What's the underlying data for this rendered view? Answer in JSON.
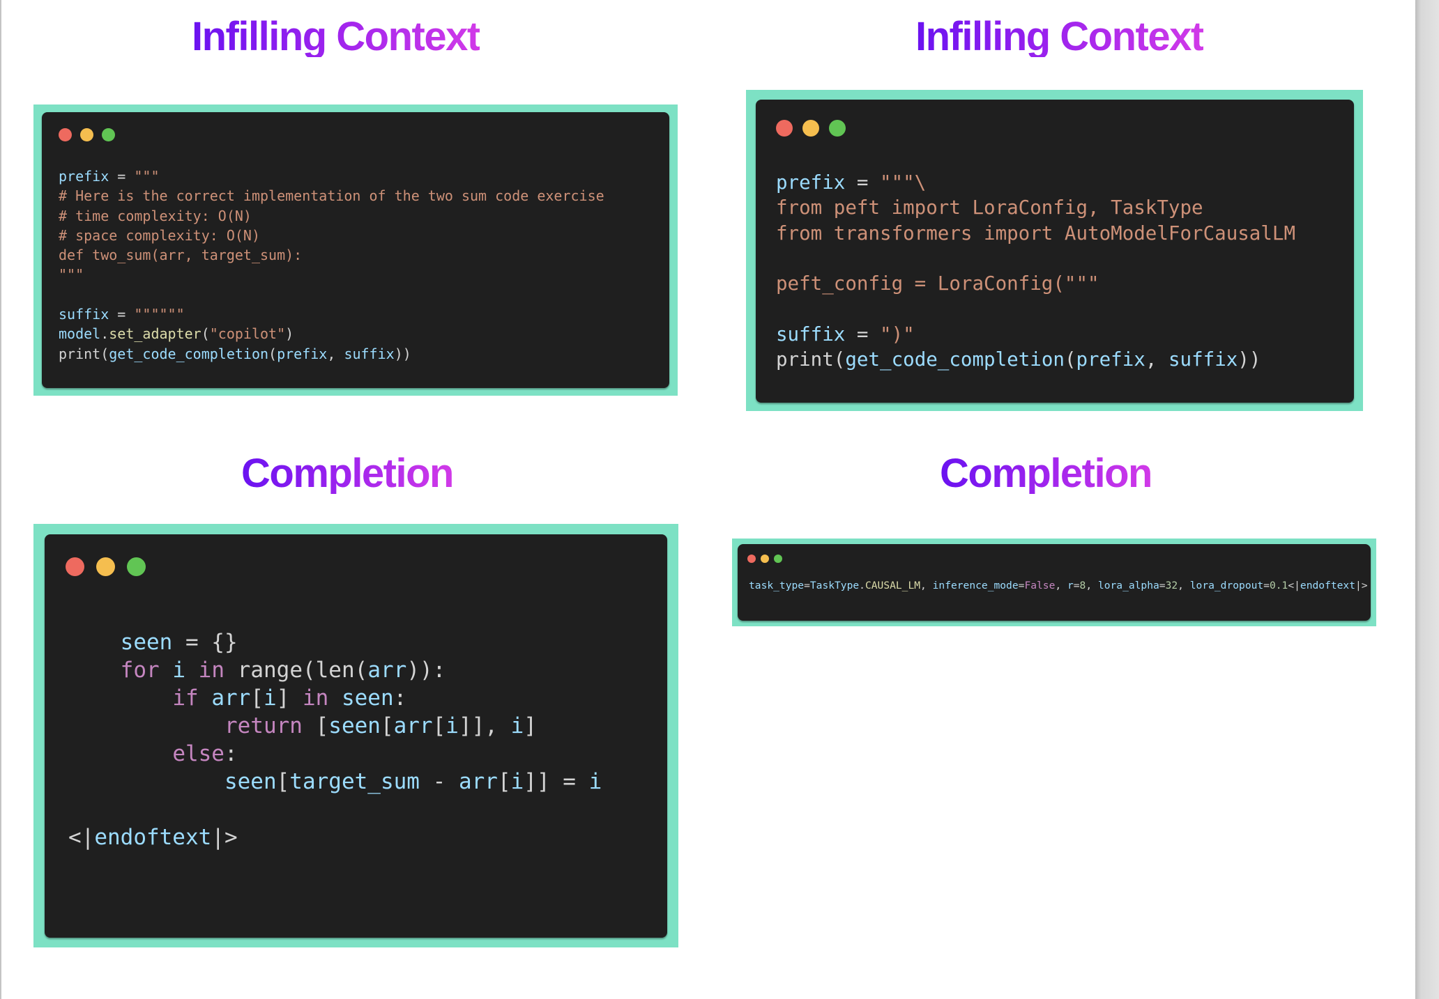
{
  "theme": {
    "frame_color": "#7de1c4",
    "window_bg": "#1f1f1f",
    "heading_gradient": [
      "#6a12f0",
      "#d13ae8"
    ],
    "traffic_lights": {
      "red": "#ee6a5f",
      "yellow": "#f5be4f",
      "green": "#61c554"
    },
    "syntax": {
      "variable": "#9cdcfe",
      "string": "#ce9178",
      "function": "#dcdcaa",
      "keyword": "#c586c0",
      "plain": "#d4d4d4",
      "number": "#b5cea8"
    }
  },
  "panels": {
    "left_context": {
      "heading": "Infilling Context",
      "window_icons": [
        "close-dot-icon",
        "minimize-dot-icon",
        "maximize-dot-icon"
      ],
      "lines": [
        [
          {
            "t": "prefix",
            "c": "var"
          },
          {
            "t": " = ",
            "c": "plain"
          },
          {
            "t": "\"\"\"",
            "c": "str"
          }
        ],
        [
          {
            "t": "# Here is the correct implementation of the two sum code exercise",
            "c": "str"
          }
        ],
        [
          {
            "t": "# time complexity: O(N)",
            "c": "str"
          }
        ],
        [
          {
            "t": "# space complexity: O(N)",
            "c": "str"
          }
        ],
        [
          {
            "t": "def two_sum(arr, target_sum):",
            "c": "str"
          }
        ],
        [
          {
            "t": "\"\"\"",
            "c": "str"
          }
        ],
        [
          {
            "t": " ",
            "c": "plain"
          }
        ],
        [
          {
            "t": "suffix",
            "c": "var"
          },
          {
            "t": " = ",
            "c": "plain"
          },
          {
            "t": "\"\"\"\"\"\"",
            "c": "str"
          }
        ],
        [
          {
            "t": "model",
            "c": "var"
          },
          {
            "t": ".",
            "c": "plain"
          },
          {
            "t": "set_adapter",
            "c": "fn"
          },
          {
            "t": "(",
            "c": "plain"
          },
          {
            "t": "\"copilot\"",
            "c": "str"
          },
          {
            "t": ")",
            "c": "plain"
          }
        ],
        [
          {
            "t": "print",
            "c": "plain"
          },
          {
            "t": "(",
            "c": "plain"
          },
          {
            "t": "get_code_completion",
            "c": "var"
          },
          {
            "t": "(",
            "c": "plain"
          },
          {
            "t": "prefix",
            "c": "var"
          },
          {
            "t": ", ",
            "c": "plain"
          },
          {
            "t": "suffix",
            "c": "var"
          },
          {
            "t": "))",
            "c": "plain"
          }
        ]
      ]
    },
    "right_context": {
      "heading": "Infilling Context",
      "window_icons": [
        "close-dot-icon",
        "minimize-dot-icon",
        "maximize-dot-icon"
      ],
      "lines": [
        [
          {
            "t": "prefix",
            "c": "var"
          },
          {
            "t": " = ",
            "c": "plain"
          },
          {
            "t": "\"\"\"\\",
            "c": "str"
          }
        ],
        [
          {
            "t": "from peft import LoraConfig, TaskType",
            "c": "str"
          }
        ],
        [
          {
            "t": "from transformers import AutoModelForCausalLM",
            "c": "str"
          }
        ],
        [
          {
            "t": " ",
            "c": "plain"
          }
        ],
        [
          {
            "t": "peft_config = LoraConfig(\"\"\"",
            "c": "str"
          }
        ],
        [
          {
            "t": " ",
            "c": "plain"
          }
        ],
        [
          {
            "t": "suffix",
            "c": "var"
          },
          {
            "t": " = ",
            "c": "plain"
          },
          {
            "t": "\")\"",
            "c": "str"
          }
        ],
        [
          {
            "t": "print",
            "c": "plain"
          },
          {
            "t": "(",
            "c": "plain"
          },
          {
            "t": "get_code_completion",
            "c": "var"
          },
          {
            "t": "(",
            "c": "plain"
          },
          {
            "t": "prefix",
            "c": "var"
          },
          {
            "t": ", ",
            "c": "plain"
          },
          {
            "t": "suffix",
            "c": "var"
          },
          {
            "t": "))",
            "c": "plain"
          }
        ]
      ]
    },
    "left_completion": {
      "heading": "Completion",
      "window_icons": [
        "close-dot-icon",
        "minimize-dot-icon",
        "maximize-dot-icon"
      ],
      "lines": [
        [
          {
            "t": " ",
            "c": "plain"
          }
        ],
        [
          {
            "t": "    ",
            "c": "plain"
          },
          {
            "t": "seen",
            "c": "var"
          },
          {
            "t": " = {}",
            "c": "plain"
          }
        ],
        [
          {
            "t": "    ",
            "c": "plain"
          },
          {
            "t": "for",
            "c": "kw"
          },
          {
            "t": " ",
            "c": "plain"
          },
          {
            "t": "i",
            "c": "var"
          },
          {
            "t": " ",
            "c": "plain"
          },
          {
            "t": "in",
            "c": "kw"
          },
          {
            "t": " range(len(",
            "c": "plain"
          },
          {
            "t": "arr",
            "c": "var"
          },
          {
            "t": ")):",
            "c": "plain"
          }
        ],
        [
          {
            "t": "        ",
            "c": "plain"
          },
          {
            "t": "if",
            "c": "kw"
          },
          {
            "t": " ",
            "c": "plain"
          },
          {
            "t": "arr",
            "c": "var"
          },
          {
            "t": "[",
            "c": "plain"
          },
          {
            "t": "i",
            "c": "var"
          },
          {
            "t": "] ",
            "c": "plain"
          },
          {
            "t": "in",
            "c": "kw"
          },
          {
            "t": " ",
            "c": "plain"
          },
          {
            "t": "seen",
            "c": "var"
          },
          {
            "t": ":",
            "c": "plain"
          }
        ],
        [
          {
            "t": "            ",
            "c": "plain"
          },
          {
            "t": "return",
            "c": "kw"
          },
          {
            "t": " [",
            "c": "plain"
          },
          {
            "t": "seen",
            "c": "var"
          },
          {
            "t": "[",
            "c": "plain"
          },
          {
            "t": "arr",
            "c": "var"
          },
          {
            "t": "[",
            "c": "plain"
          },
          {
            "t": "i",
            "c": "var"
          },
          {
            "t": "]], ",
            "c": "plain"
          },
          {
            "t": "i",
            "c": "var"
          },
          {
            "t": "]",
            "c": "plain"
          }
        ],
        [
          {
            "t": "        ",
            "c": "plain"
          },
          {
            "t": "else",
            "c": "kw"
          },
          {
            "t": ":",
            "c": "plain"
          }
        ],
        [
          {
            "t": "            ",
            "c": "plain"
          },
          {
            "t": "seen",
            "c": "var"
          },
          {
            "t": "[",
            "c": "plain"
          },
          {
            "t": "target_sum",
            "c": "var"
          },
          {
            "t": " - ",
            "c": "plain"
          },
          {
            "t": "arr",
            "c": "var"
          },
          {
            "t": "[",
            "c": "plain"
          },
          {
            "t": "i",
            "c": "var"
          },
          {
            "t": "]] = ",
            "c": "plain"
          },
          {
            "t": "i",
            "c": "var"
          }
        ],
        [
          {
            "t": " ",
            "c": "plain"
          }
        ],
        [
          {
            "t": "<|",
            "c": "plain"
          },
          {
            "t": "endoftext",
            "c": "var"
          },
          {
            "t": "|>",
            "c": "plain"
          }
        ]
      ]
    },
    "right_completion": {
      "heading": "Completion",
      "window_icons": [
        "close-dot-icon",
        "minimize-dot-icon",
        "maximize-dot-icon"
      ],
      "lines": [
        [
          {
            "t": "task_type",
            "c": "var"
          },
          {
            "t": "=",
            "c": "plain"
          },
          {
            "t": "TaskType",
            "c": "var"
          },
          {
            "t": ".",
            "c": "plain"
          },
          {
            "t": "CAUSAL_LM",
            "c": "fn"
          },
          {
            "t": ", ",
            "c": "plain"
          },
          {
            "t": "inference_mode",
            "c": "var"
          },
          {
            "t": "=",
            "c": "plain"
          },
          {
            "t": "False",
            "c": "kw"
          },
          {
            "t": ", ",
            "c": "plain"
          },
          {
            "t": "r",
            "c": "var"
          },
          {
            "t": "=",
            "c": "plain"
          },
          {
            "t": "8",
            "c": "num"
          },
          {
            "t": ", ",
            "c": "plain"
          },
          {
            "t": "lora_alpha",
            "c": "var"
          },
          {
            "t": "=",
            "c": "plain"
          },
          {
            "t": "32",
            "c": "num"
          },
          {
            "t": ", ",
            "c": "plain"
          },
          {
            "t": "lora_dropout",
            "c": "var"
          },
          {
            "t": "=",
            "c": "plain"
          },
          {
            "t": "0.1",
            "c": "num"
          },
          {
            "t": "<|",
            "c": "plain"
          },
          {
            "t": "endoftext",
            "c": "var"
          },
          {
            "t": "|>",
            "c": "plain"
          }
        ]
      ]
    }
  }
}
